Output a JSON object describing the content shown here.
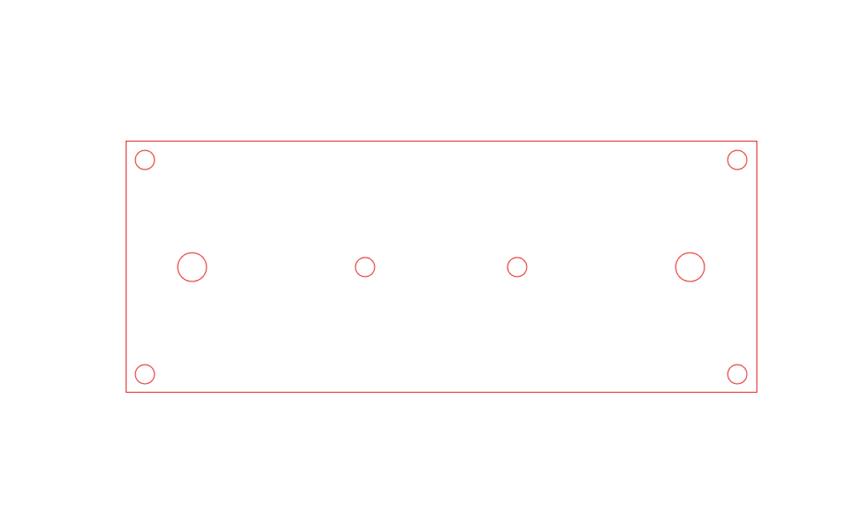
{
  "drawing": {
    "stroke_color": "#e00000",
    "background_color": "#ffffff",
    "panel": {
      "shape": "rectangle",
      "holes": [
        {
          "id": "mount-top-left",
          "kind": "mounting-hole",
          "size": "small"
        },
        {
          "id": "mount-top-right",
          "kind": "mounting-hole",
          "size": "small"
        },
        {
          "id": "mount-bottom-left",
          "kind": "mounting-hole",
          "size": "small"
        },
        {
          "id": "mount-bottom-right",
          "kind": "mounting-hole",
          "size": "small"
        },
        {
          "id": "center-left-large",
          "kind": "cutout-hole",
          "size": "large"
        },
        {
          "id": "center-left-small",
          "kind": "cutout-hole",
          "size": "small"
        },
        {
          "id": "center-right-small",
          "kind": "cutout-hole",
          "size": "small"
        },
        {
          "id": "center-right-large",
          "kind": "cutout-hole",
          "size": "large"
        }
      ]
    }
  }
}
